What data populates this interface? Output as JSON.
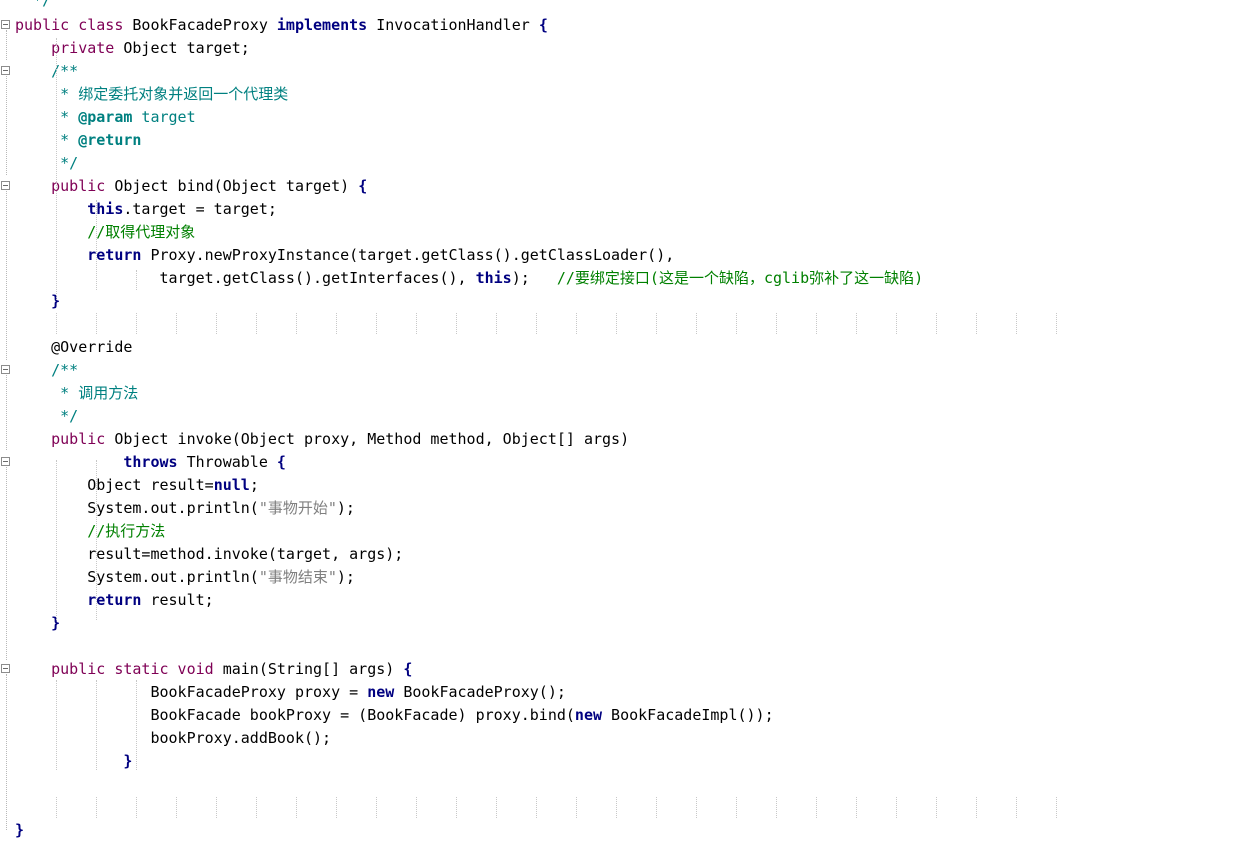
{
  "editor": {
    "language": "Java",
    "colors": {
      "background": "#ffffff",
      "keyword": "#7f0055",
      "keyword_bold": "#000080",
      "comment": "#008080",
      "line_comment": "#008000",
      "string": "#808080",
      "guide": "#c8c8c8"
    },
    "lines": [
      {
        "tokens": [
          {
            "t": "  */",
            "c": "tok-cmt"
          }
        ]
      },
      {
        "tokens": [
          {
            "t": "public class ",
            "c": "tok-kw"
          },
          {
            "t": "BookFacadeProxy ",
            "c": "tok-type"
          },
          {
            "t": "implements",
            "c": "tok-kwb"
          },
          {
            "t": " InvocationHandler ",
            "c": "tok-type"
          },
          {
            "t": "{",
            "c": "tok-op"
          }
        ]
      },
      {
        "tokens": [
          {
            "t": "    ",
            "c": "tok-type"
          },
          {
            "t": "private ",
            "c": "tok-kw"
          },
          {
            "t": "Object target;",
            "c": "tok-type"
          }
        ]
      },
      {
        "tokens": [
          {
            "t": "    /**",
            "c": "tok-cmt"
          }
        ]
      },
      {
        "tokens": [
          {
            "t": "     * 绑定委托对象并返回一个代理类",
            "c": "tok-cmt"
          }
        ]
      },
      {
        "tokens": [
          {
            "t": "     * ",
            "c": "tok-cmt"
          },
          {
            "t": "@param",
            "c": "tok-annb"
          },
          {
            "t": " target",
            "c": "tok-cmt"
          }
        ]
      },
      {
        "tokens": [
          {
            "t": "     * ",
            "c": "tok-cmt"
          },
          {
            "t": "@return",
            "c": "tok-annb"
          }
        ]
      },
      {
        "tokens": [
          {
            "t": "     */",
            "c": "tok-cmt"
          }
        ]
      },
      {
        "tokens": [
          {
            "t": "    ",
            "c": "tok-type"
          },
          {
            "t": "public ",
            "c": "tok-kw"
          },
          {
            "t": "Object bind(Object target) ",
            "c": "tok-type"
          },
          {
            "t": "{",
            "c": "tok-op"
          }
        ]
      },
      {
        "tokens": [
          {
            "t": "        ",
            "c": "tok-type"
          },
          {
            "t": "this",
            "c": "tok-kwb"
          },
          {
            "t": ".target = target;",
            "c": "tok-type"
          }
        ]
      },
      {
        "tokens": [
          {
            "t": "        //取得代理对象",
            "c": "tok-grn"
          }
        ]
      },
      {
        "tokens": [
          {
            "t": "        ",
            "c": "tok-type"
          },
          {
            "t": "return",
            "c": "tok-kwb"
          },
          {
            "t": " Proxy.newProxyInstance(target.getClass().getClassLoader(),",
            "c": "tok-type"
          }
        ]
      },
      {
        "tokens": [
          {
            "t": "                target.getClass().getInterfaces(), ",
            "c": "tok-type"
          },
          {
            "t": "this",
            "c": "tok-kwb"
          },
          {
            "t": ");   ",
            "c": "tok-type"
          },
          {
            "t": "//要绑定接口(这是一个缺陷，cglib弥补了这一缺陷)",
            "c": "tok-grn"
          }
        ]
      },
      {
        "tokens": [
          {
            "t": "    ",
            "c": "tok-type"
          },
          {
            "t": "}",
            "c": "tok-op"
          }
        ]
      },
      {
        "tokens": [
          {
            "t": "",
            "c": "tok-type"
          }
        ]
      },
      {
        "tokens": [
          {
            "t": "    @Override",
            "c": "tok-ann"
          }
        ]
      },
      {
        "tokens": [
          {
            "t": "    /**",
            "c": "tok-cmt"
          }
        ]
      },
      {
        "tokens": [
          {
            "t": "     * 调用方法",
            "c": "tok-cmt"
          }
        ]
      },
      {
        "tokens": [
          {
            "t": "     */",
            "c": "tok-cmt"
          }
        ]
      },
      {
        "tokens": [
          {
            "t": "    ",
            "c": "tok-type"
          },
          {
            "t": "public ",
            "c": "tok-kw"
          },
          {
            "t": "Object invoke(Object proxy, Method method, Object[] args)",
            "c": "tok-type"
          }
        ]
      },
      {
        "tokens": [
          {
            "t": "            ",
            "c": "tok-type"
          },
          {
            "t": "throws",
            "c": "tok-kwb"
          },
          {
            "t": " Throwable ",
            "c": "tok-type"
          },
          {
            "t": "{",
            "c": "tok-op"
          }
        ]
      },
      {
        "tokens": [
          {
            "t": "        Object result=",
            "c": "tok-type"
          },
          {
            "t": "null",
            "c": "tok-kwb"
          },
          {
            "t": ";",
            "c": "tok-type"
          }
        ]
      },
      {
        "tokens": [
          {
            "t": "        System.out.println(",
            "c": "tok-type"
          },
          {
            "t": "\"事物开始\"",
            "c": "tok-str"
          },
          {
            "t": ");",
            "c": "tok-type"
          }
        ]
      },
      {
        "tokens": [
          {
            "t": "        //执行方法",
            "c": "tok-grn"
          }
        ]
      },
      {
        "tokens": [
          {
            "t": "        result=method.invoke(target, args);",
            "c": "tok-type"
          }
        ]
      },
      {
        "tokens": [
          {
            "t": "        System.out.println(",
            "c": "tok-type"
          },
          {
            "t": "\"事物结束\"",
            "c": "tok-str"
          },
          {
            "t": ");",
            "c": "tok-type"
          }
        ]
      },
      {
        "tokens": [
          {
            "t": "        ",
            "c": "tok-type"
          },
          {
            "t": "return",
            "c": "tok-kwb"
          },
          {
            "t": " result;",
            "c": "tok-type"
          }
        ]
      },
      {
        "tokens": [
          {
            "t": "    ",
            "c": "tok-type"
          },
          {
            "t": "}",
            "c": "tok-op"
          }
        ]
      },
      {
        "tokens": [
          {
            "t": "",
            "c": "tok-type"
          }
        ]
      },
      {
        "tokens": [
          {
            "t": "    ",
            "c": "tok-type"
          },
          {
            "t": "public static void ",
            "c": "tok-kw"
          },
          {
            "t": "main(String[] args) ",
            "c": "tok-type"
          },
          {
            "t": "{",
            "c": "tok-op"
          }
        ]
      },
      {
        "tokens": [
          {
            "t": "               BookFacadeProxy proxy = ",
            "c": "tok-type"
          },
          {
            "t": "new",
            "c": "tok-kwb"
          },
          {
            "t": " BookFacadeProxy();",
            "c": "tok-type"
          }
        ]
      },
      {
        "tokens": [
          {
            "t": "               BookFacade bookProxy = (BookFacade) proxy.bind(",
            "c": "tok-type"
          },
          {
            "t": "new",
            "c": "tok-kwb"
          },
          {
            "t": " BookFacadeImpl());",
            "c": "tok-type"
          }
        ]
      },
      {
        "tokens": [
          {
            "t": "               bookProxy.addBook();",
            "c": "tok-type"
          }
        ]
      },
      {
        "tokens": [
          {
            "t": "            ",
            "c": "tok-type"
          },
          {
            "t": "}",
            "c": "tok-op"
          }
        ]
      },
      {
        "tokens": [
          {
            "t": "",
            "c": "tok-type"
          }
        ]
      },
      {
        "tokens": [
          {
            "t": "",
            "c": "tok-type"
          }
        ]
      },
      {
        "tokens": [
          {
            "t": "}",
            "c": "tok-op"
          }
        ]
      }
    ]
  }
}
